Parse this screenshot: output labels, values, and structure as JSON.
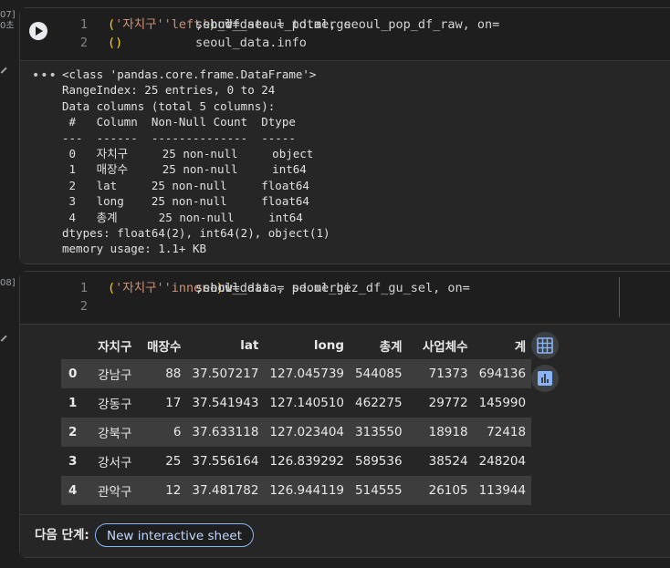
{
  "cell1": {
    "exec_count_top": "07]",
    "exec_time": "0초",
    "lines": [
      {
        "n": "1",
        "parts": [
          {
            "t": "seoul_data = pd.merge",
            "c": "code"
          },
          {
            "t": "(",
            "c": "paren"
          },
          {
            "t": " sb_df_seoul_total, seoul_pop_df_raw, on=",
            "c": "code"
          },
          {
            "t": "'자치구'",
            "c": "str"
          },
          {
            "t": ", how=",
            "c": "code"
          },
          {
            "t": "'left'",
            "c": "str"
          },
          {
            "t": ")",
            "c": "paren"
          }
        ]
      },
      {
        "n": "2",
        "parts": [
          {
            "t": "seoul_data.info",
            "c": "code"
          },
          {
            "t": "()",
            "c": "paren"
          }
        ]
      }
    ],
    "output": "<class 'pandas.core.frame.DataFrame'>\nRangeIndex: 25 entries, 0 to 24\nData columns (total 5 columns):\n #   Column  Non-Null Count  Dtype  \n---  ------  --------------  -----  \n 0   자치구     25 non-null     object \n 1   매장수     25 non-null     int64  \n 2   lat     25 non-null     float64\n 3   long    25 non-null     float64\n 4   총계      25 non-null     int64  \ndtypes: float64(2), int64(2), object(1)\nmemory usage: 1.1+ KB"
  },
  "cell2": {
    "exec_count_top": "08]",
    "lines": [
      {
        "n": "1",
        "parts": [
          {
            "t": "seoul_data = pd.merge",
            "c": "code"
          },
          {
            "t": "(",
            "c": "paren"
          },
          {
            "t": " seoul_data, seoul_biz_df_gu_sel, on=",
            "c": "code"
          },
          {
            "t": "'자치구'",
            "c": "str"
          },
          {
            "t": ", how=",
            "c": "code"
          },
          {
            "t": "'inner'",
            "c": "str"
          },
          {
            "t": ")",
            "c": "paren"
          }
        ]
      },
      {
        "n": "2",
        "parts": []
      }
    ],
    "table": {
      "columns": [
        "자치구",
        "매장수",
        "lat",
        "long",
        "총계",
        "사업체수",
        "계"
      ],
      "rows": [
        {
          "idx": "0",
          "cells": [
            "강남구",
            "88",
            "37.507217",
            "127.045739",
            "544085",
            "71373",
            "694136"
          ]
        },
        {
          "idx": "1",
          "cells": [
            "강동구",
            "17",
            "37.541943",
            "127.140510",
            "462275",
            "29772",
            "145990"
          ]
        },
        {
          "idx": "2",
          "cells": [
            "강북구",
            "6",
            "37.633118",
            "127.023404",
            "313550",
            "18918",
            "72418"
          ]
        },
        {
          "idx": "3",
          "cells": [
            "강서구",
            "25",
            "37.556164",
            "126.839292",
            "589536",
            "38524",
            "248204"
          ]
        },
        {
          "idx": "4",
          "cells": [
            "관악구",
            "12",
            "37.481782",
            "126.944119",
            "514555",
            "26105",
            "113944"
          ]
        }
      ]
    },
    "next_step_label": "다음 단계:",
    "new_sheet_button": "New interactive sheet"
  },
  "icons": {
    "run": "play-icon",
    "more": "more-horiz-icon",
    "table": "table-icon",
    "chart": "bar-chart-icon"
  },
  "colors": {
    "string": "#ce9178",
    "paren": "#ffd700",
    "accent": "#8ab4f8"
  }
}
